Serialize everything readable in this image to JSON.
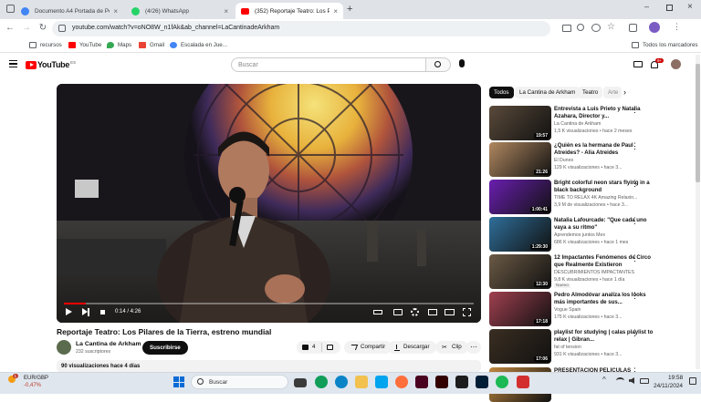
{
  "browser": {
    "tabs": [
      {
        "title": "Documento A4 Portada de Por",
        "color": "#4285f4"
      },
      {
        "title": "(4/26) WhatsApp",
        "color": "#25d366"
      },
      {
        "title": "(352) Reportaje Teatro: Los Pilar",
        "color": "#ff0000"
      }
    ],
    "url": "youtube.com/watch?v=oNO8W_n1fAk&ab_channel=LaCantinadeArkham",
    "bookmarks": [
      {
        "label": "recursos",
        "color": "#5f6368"
      },
      {
        "label": "YouTube",
        "color": "#ff0000"
      },
      {
        "label": "Maps",
        "color": "#34a853"
      },
      {
        "label": "Gmail",
        "color": "#ea4335"
      },
      {
        "label": "Escalada en Jue...",
        "color": "#4285f4"
      }
    ],
    "all_bookmarks": "Todos los marcadores"
  },
  "youtube": {
    "logo": "YouTube",
    "region": "ES",
    "search_placeholder": "Buscar",
    "notifications": "9+",
    "video": {
      "title": "Reportaje Teatro: Los Pilares de la Tierra, estreno mundial",
      "time": "0:14 / 4:26",
      "progress": 0.053,
      "channel": "La Cantina de Arkham",
      "subscribers": "232 suscriptores",
      "subscribe": "Suscribirse",
      "likes": "4",
      "share": "Compartir",
      "download": "Descargar",
      "clip": "Clip",
      "views": "90 visualizaciones  hace 4 días"
    },
    "chips": [
      "Todos",
      "La Cantina de Arkham",
      "Teatro",
      "Arte"
    ],
    "recommendations": [
      {
        "title": "Entrevista a Luis Prieto y Natalia Azahara, Director y...",
        "channel": "La Cantina de Arkham",
        "meta": "1,5 K visualizaciones • hace 2 meses",
        "duration": "19:57",
        "color": "#5a4a3a"
      },
      {
        "title": "¿Quién es la hermana de Paul Atreides? - Alia Atreides",
        "channel": "El Dunes",
        "meta": "129 K visualizaciones • hace 3...",
        "duration": "21:26",
        "color": "#b08860"
      },
      {
        "title": "Bright colorful neon stars flying in a black background",
        "channel": "TIME TO RELAX 4K Amazing Relaxin...",
        "meta": "3,9 M de visualizaciones • hace 3...",
        "duration": "1:00:41",
        "color": "#6a1fb0"
      },
      {
        "title": "Natalia Lafourcade: \"Que cada uno vaya a su ritmo\"",
        "channel": "Aprendemos juntos Mex",
        "meta": "686 K visualizaciones • hace 1 mes",
        "duration": "1:29:30",
        "color": "#2f6f9a"
      },
      {
        "title": "12 Impactantes Fenómenos de Circo que Realmente Existieron",
        "channel": "DESCUBRIMIENTOS IMPACTANTES",
        "meta": "9,8 K visualizaciones • hace 1 día",
        "duration": "12:30",
        "color": "#6b5a45",
        "badge": "Nuevo"
      },
      {
        "title": "Pedro Almodóvar analiza los looks más importantes de sus...",
        "channel": "Vogue Spain",
        "meta": "175 K visualizaciones • hace 3...",
        "duration": "17:18",
        "color": "#a04050"
      },
      {
        "title": "playlist for studying | calas playlist to relax | Gibran...",
        "channel": "fat of tension",
        "meta": "931 K visualizaciones • hace 3...",
        "duration": "17:06",
        "color": "#3a2e22"
      },
      {
        "title": "PRESENTACIÓN PELÍCULAS",
        "channel": "",
        "meta": "",
        "duration": "",
        "color": "#c08840"
      }
    ]
  },
  "taskbar": {
    "ticker": "EUR/GBP",
    "ticker_change": "-0,47%",
    "alert_count": "1",
    "search": "Buscar",
    "time": "19:58",
    "date": "24/11/2024"
  }
}
